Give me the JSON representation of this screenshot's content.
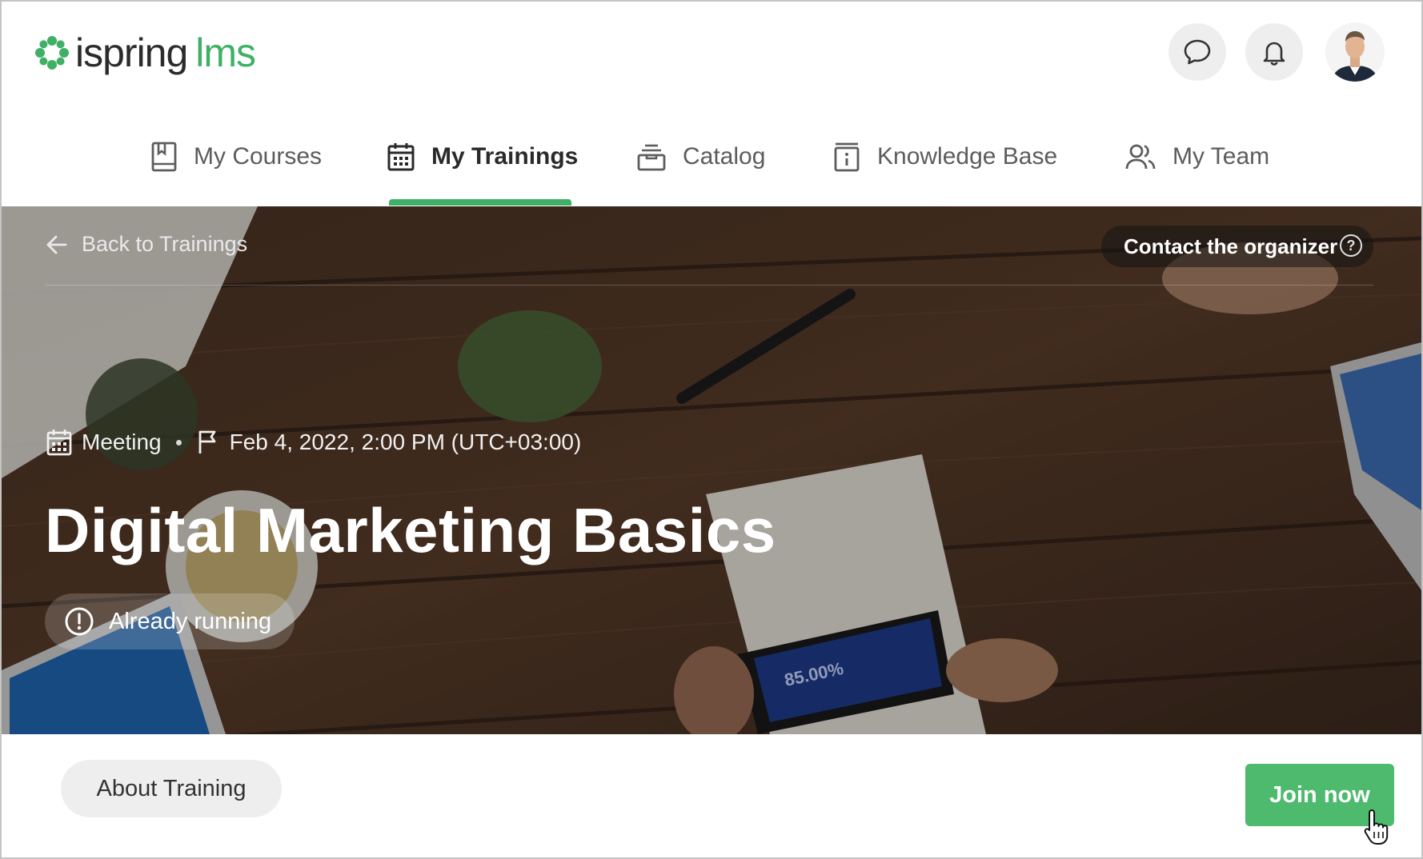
{
  "header": {
    "logo": {
      "primary": "ispring",
      "secondary": "lms"
    },
    "chat_icon": "chat-bubble-icon",
    "notifications_icon": "bell-icon"
  },
  "nav": {
    "items": [
      {
        "label": "My Courses",
        "icon": "book-icon",
        "active": false
      },
      {
        "label": "My Trainings",
        "icon": "calendar-icon",
        "active": true
      },
      {
        "label": "Catalog",
        "icon": "catalog-icon",
        "active": false
      },
      {
        "label": "Knowledge Base",
        "icon": "knowledge-base-icon",
        "active": false
      },
      {
        "label": "My Team",
        "icon": "team-icon",
        "active": false
      }
    ],
    "accent_color": "#3fb066"
  },
  "hero": {
    "back_label": "Back to Trainings",
    "contact_label": "Contact the organizer",
    "contact_help": "?",
    "type": "Meeting",
    "datetime": "Feb 4, 2022, 2:00 PM (UTC+03:00)",
    "title": "Digital Marketing Basics",
    "status": "Already running",
    "phone_value": "85.00%"
  },
  "footer": {
    "about_label": "About Training",
    "join_label": "Join now",
    "join_color": "#4dba6e"
  }
}
